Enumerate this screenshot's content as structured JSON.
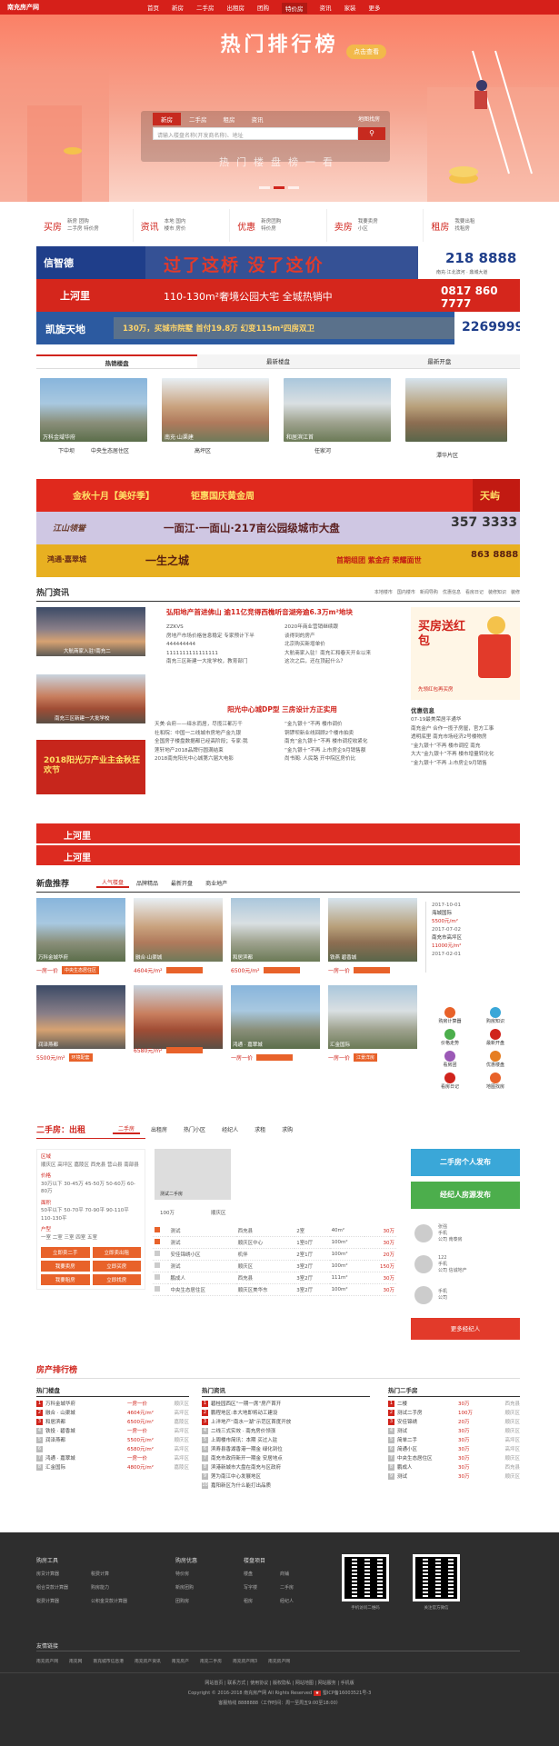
{
  "topnav": {
    "logo": "南充房产网",
    "items": [
      "首页",
      "新房",
      "二手房",
      "出租房",
      "团购",
      "特价房",
      "资讯",
      "家装",
      "更多"
    ],
    "active": 5
  },
  "banner": {
    "title": "热门排行榜",
    "button": "点击查看",
    "search_tabs": [
      "新房",
      "二手房",
      "租房",
      "资讯"
    ],
    "search_placeholder": "请输入楼盘名称(开发商名称)、地址",
    "map_link": "地图找房",
    "hot_line": "热门楼盘榜一看"
  },
  "categories": [
    {
      "title": "买房",
      "sub": [
        "新房",
        "团购",
        "二手房",
        "特价房"
      ]
    },
    {
      "title": "资讯",
      "sub": [
        "本地",
        "国内",
        "楼市",
        "房价"
      ]
    },
    {
      "title": "优惠",
      "sub": [
        "新房团购",
        "特价房"
      ]
    },
    {
      "title": "卖房",
      "sub": [
        "我要卖房",
        "小区"
      ]
    },
    {
      "title": "租房",
      "sub": [
        "我要出租",
        "找租房"
      ]
    }
  ],
  "ads": [
    {
      "brand": "信智德",
      "slogan": "过了这桥 没了这价",
      "phone": "218 8888",
      "sub": "南充·江北滨河 · 鼎城大道"
    },
    {
      "brand": "上河里",
      "slogan": "110-130m²奢境公园大宅 全城热销中",
      "phone": "0817 860 7777"
    },
    {
      "brand": "凯旋天地",
      "slogan": "130万，买城市院墅 首付19.8万 幻变115m²四房双卫",
      "phone": "2269999"
    },
    {
      "brand": "金秋十月【美好季】",
      "slogan": "钜惠国庆黄金周",
      "right": "天屿"
    },
    {
      "brand": "江山领誉",
      "slogan": "一面江·一面山·217亩公园级城市大盘",
      "phone": "357 3333"
    },
    {
      "brand": "鸿通·嘉翠城",
      "slogan": "一生之城",
      "tag": "首期组团 紫金府 荣耀面世",
      "phone": "863 8888"
    }
  ],
  "hot_tabs": {
    "items": [
      "热销楼盘",
      "最新楼盘",
      "最新开盘"
    ],
    "active": 0
  },
  "hot_projects": [
    {
      "name": "万科金域华府",
      "area": "",
      "sub": "下中坝",
      "note": "中央生态居住区"
    },
    {
      "name": "凤凰台",
      "area": "南充·山渠建",
      "sub": "高坪区",
      "note": ""
    },
    {
      "name": "和居滨江首",
      "area": "",
      "sub": "任家河",
      "note": ""
    },
    {
      "name": "",
      "area": "",
      "sub": "潭华片区",
      "note": ""
    }
  ],
  "news": {
    "title": "热门资讯",
    "tabs": [
      "本地楼市",
      "国内楼市",
      "新闻导购",
      "优惠信息",
      "看房日记",
      "装修知识",
      "装修"
    ],
    "img_captions": [
      "大航商家入驻!南充二",
      "南充三区新建一大批学校",
      "2018阳光万产业主金秋狂欢节"
    ],
    "headline1": "弘阳地产首进佛山 逾11亿竞得西樵听音湖旁逾6.3万m²地块",
    "headline2": "阳光中心城DP型 三房设计方正实用",
    "listA": [
      "ZZKVS",
      "房地产市场价格信息稳定 专家预计下半",
      "444444444",
      "1111111111111111",
      "南充三区新建一大批学校，教育部门",
      "天美·合府——绎水而居，尽揽江都万千",
      "社和院：中国一二线城市房地产金九银",
      "全国房子楼盘数据都已经高阶段；专家:我",
      "莲轩地产2018品牌行圆满结束",
      "2018南充阳光中心城第六届大电影"
    ],
    "listB": [
      "2020年商业营销继续跟",
      "谈得到的房产",
      "北京购买新增单价",
      "大航商家入驻！南充汇和春天开业以来",
      "这次之后，还在顶起什么？",
      "“金九银十”不再 楼市调价",
      "铜锣坝新业线回顾2个楼市拍卖",
      "南充“金九银十”不再 楼市调控收紧化",
      "“金九银十”不再 上市房企9月销售额",
      "尚书阁: 人民路 开中院区房价比",
      "金山房园 | 中铁业主客家嘉遇 七伯"
    ],
    "promo_title": "买房送红包",
    "promo_sub": "先领红包再买房",
    "offer_title": "优惠信息",
    "offers": [
      "07-19最美荣居平通华",
      "南充金户 合作一揽子房屋，官方工事",
      "透明底里 南充市场经济2号楼物房",
      "“金九银十”不再 楼市调控 南充",
      "大大“金九银十”不再 楼市增量转化化",
      "“金九银十”不再 上市房企9月销售"
    ]
  },
  "strip_brand": "上河里",
  "newhouse": {
    "title": "新盘推荐",
    "tabs": [
      "人气楼盘",
      "品牌精品",
      "最新开盘",
      "商业地产"
    ],
    "active": 0,
    "items": [
      {
        "name": "万科金城华府",
        "tag": "中央生态居住区",
        "price": "一房一价"
      },
      {
        "name": "融合·山渠城",
        "tag": "",
        "price": "4604元/m²"
      },
      {
        "name": "和居滨都",
        "tag": "",
        "price": "6500元/m²"
      },
      {
        "name": "铁燕 碧香城",
        "tag": "",
        "price": "一房一价"
      },
      {
        "name": "润泽燕都",
        "tag": "环境配套",
        "price": "5500元/m²"
      },
      {
        "name": "",
        "tag": "",
        "price": "6580元/m²"
      },
      {
        "name": "鸿通 · 嘉翠城",
        "tag": "",
        "price": "一房一价"
      },
      {
        "name": "汇金国际",
        "tag": "江景洋房",
        "price": "一房一价"
      }
    ],
    "timeline": [
      {
        "date": "2017-10-01",
        "title": "海城国际",
        "price": "5500元/m²"
      },
      {
        "date": "2017-07-02",
        "title": "南充市高坪区",
        "price": "11000元/m²"
      },
      {
        "date": "2017-02-01",
        "title": "",
        "price": ""
      }
    ],
    "tools": [
      "购房计算器",
      "购房知识",
      "价格走势",
      "最新开盘",
      "看房团",
      "优惠楼盘",
      "看房日记",
      "地图找房"
    ]
  },
  "second": {
    "title": "二手房：出租",
    "tabs": [
      "二手房",
      "出租房",
      "热门小区",
      "经纪人",
      "求租",
      "求购"
    ],
    "active": 0,
    "filters": [
      {
        "label": "区域",
        "items": "顺庆区 高坪区 嘉陵区 西充县 营山县 南部县"
      },
      {
        "label": "价格",
        "items": "30万以下 30-45万 45-50万 50-60万 60-80万"
      },
      {
        "label": "面积",
        "items": "50平以下 50-70平 70-90平 90-110平 110-130平"
      },
      {
        "label": "户型",
        "items": "一室 二室 三室 四室 五室"
      }
    ],
    "buttons": [
      "立即卖二手",
      "立即卖出租",
      "我要卖房",
      "立即买房",
      "我要租房",
      "立即找房"
    ],
    "feature": {
      "title": "测试二手房",
      "price": "100万",
      "loc": "顺庆区"
    },
    "rows": [
      [
        "测试",
        "",
        "西充县",
        "2室",
        "40m²",
        "30万"
      ],
      [
        "测试",
        "",
        "顺庆区中心",
        "1室0厅",
        "100m²",
        "30万"
      ],
      [
        "安佳锦绣小区",
        "",
        "机伴",
        "2室1厅",
        "100m²",
        "20万"
      ],
      [
        "测试",
        "",
        "顺庆区",
        "3室2厅",
        "100m²",
        "150万"
      ],
      [
        "鹏成人",
        "",
        "西充县",
        "3室2厅",
        "111m²",
        "30万"
      ],
      [
        "中央生态居住区",
        "",
        "顺庆区美华东",
        "3室2厅",
        "100m²",
        "30万"
      ]
    ],
    "publish": [
      "二手房个人发布",
      "经纪人房源发布"
    ],
    "agents": [
      {
        "name": "张强",
        "phone": "手机",
        "co": "公司 南泰房"
      },
      {
        "name": "122",
        "phone": "手机",
        "co": "公司 信诚地产"
      },
      {
        "name": "",
        "phone": "手机",
        "co": "公司"
      }
    ],
    "more_agents": "更多经纪人"
  },
  "rank": {
    "title": "房产排行榜",
    "cols": [
      {
        "title": "热门楼盘",
        "items": [
          [
            "万科金城华府",
            "一房一价",
            "顺庆区"
          ],
          [
            "融合 · 山渠城",
            "4604元/m²",
            "高坪区"
          ],
          [
            "和居滨都",
            "6500元/m²",
            "嘉陵区"
          ],
          [
            "铁投 · 碧香城",
            "一房一价",
            "高坪区"
          ],
          [
            "润泽燕都",
            "5500元/m²",
            "顺庆区"
          ],
          [
            "",
            "6580元/m²",
            "高坪区"
          ],
          [
            "鸿通 · 嘉翠城",
            "一房一价",
            "高坪区"
          ],
          [
            "汇金国际",
            "4800元/m²",
            "嘉陵区"
          ]
        ]
      },
      {
        "title": "热门资讯",
        "items": [
          "碧桂园西区“一期一席”房产首开",
          "鹏程地区:本大地即将动工建设",
          "上洋地产“南水一湖”示范区首度开放",
          "二线三式实效 · 南充房价领涨",
          "上周楼市简讯：本期 买过入驻",
          "滨寿县香湖香港一期金 绿化到位",
          "南充市政府新开一期金 安居地点",
          "滨港新城市大盘在南充与区政府",
          "莲为南江中心发展地区",
          "嘉阳新区为什么能打出品质"
        ]
      },
      {
        "title": "热门二手房",
        "items": [
          [
            "二楼",
            "30万",
            "西充县"
          ],
          [
            "测试二手房",
            "100万",
            "顺庆区"
          ],
          [
            "安佳锦绣",
            "20万",
            "顺庆区"
          ],
          [
            "测试",
            "30万",
            "顺庆区"
          ],
          [
            "简单二手",
            "30万",
            "高坪区"
          ],
          [
            "简通小区",
            "30万",
            "高坪区"
          ],
          [
            "中央生态居住区",
            "30万",
            "顺庆区"
          ],
          [
            "鹏成人",
            "30万",
            "西充县"
          ],
          [
            "测试",
            "30万",
            "顺庆区"
          ]
        ]
      }
    ]
  },
  "footer": {
    "col1_title": "购房工具",
    "col1": [
      "房贷计算器",
      "税费计算",
      "组合贷款计算器",
      "购房能力",
      "税费计算器",
      "公积金贷款计算器"
    ],
    "col2_title": "购房优惠",
    "col2": [
      "特价房",
      "新房团购",
      "团购房"
    ],
    "col3_title": "楼盘项目",
    "col3": [
      "楼盘",
      "商铺",
      "写字楼",
      "二手房",
      "租房",
      "经纪人"
    ],
    "qr_labels": [
      "手机访问二维码",
      "关注官方微信"
    ],
    "links_title": "友情链接",
    "links": [
      "南充房产网",
      "南充网",
      "南充城市信息港",
      "南充房产资讯",
      "南充房产",
      "南充二手房",
      "南充房产网3",
      "南充房产网"
    ],
    "bottom_links": "网站首页 | 联系方式 | 使用协议 | 版权隐私 | 网站地图 | 网站服务 | 手机版",
    "copyright": "Copyright © 2016-2018 南充房产网 All Rights Reserved",
    "icp": "蜀ICP备16003521号-3",
    "tel": "客服热线 8888888（工作时间：周一至周五9:00至18:00）"
  }
}
